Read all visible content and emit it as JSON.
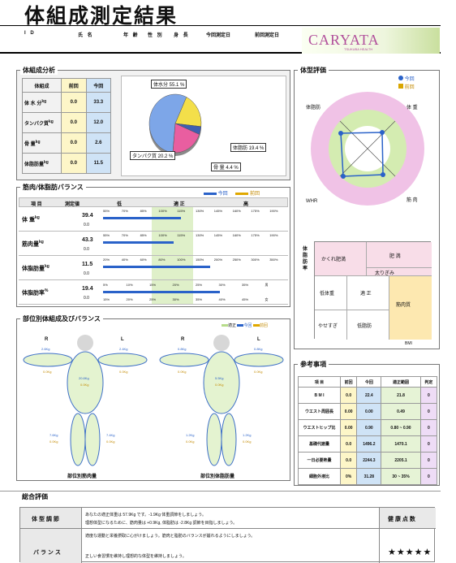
{
  "title": "体組成測定結果",
  "header": {
    "cols": [
      "I D",
      "氏 名",
      "年 齢",
      "性 別",
      "身 長",
      "今回測定日",
      "前回測定日"
    ],
    "logo": "CARYATA",
    "logo_sub": "TSUKUBA HEALTH"
  },
  "body_comp": {
    "title": "体組成分析",
    "headers": [
      "体組成",
      "前回",
      "今回"
    ],
    "rows": [
      {
        "label": "体 水 分",
        "unit": "kg",
        "prev": "0.0",
        "curr": "33.3"
      },
      {
        "label": "タンパク質",
        "unit": "kg",
        "prev": "0.0",
        "curr": "12.0"
      },
      {
        "label": "骨 量",
        "unit": "kg",
        "prev": "0.0",
        "curr": "2.6"
      },
      {
        "label": "体脂肪量",
        "unit": "kg",
        "prev": "0.0",
        "curr": "11.5"
      }
    ],
    "pie_labels": [
      "体水分 55.1 %",
      "タンパク質 20.2 %",
      "骨 量 4.4 %",
      "体脂肪 19.4 %"
    ]
  },
  "chart_data": {
    "type": "pie",
    "categories": [
      "体水分",
      "タンパク質",
      "骨 量",
      "体脂肪"
    ],
    "values": [
      55.1,
      20.2,
      4.4,
      19.4
    ],
    "colors": [
      "#7da6e8",
      "#e95ea0",
      "#3f5fb0",
      "#f3df4a"
    ]
  },
  "balance": {
    "title": "筋肉/体脂肪バランス",
    "legend": [
      "今回",
      "前回"
    ],
    "headers": [
      "項 目",
      "測定値",
      "低",
      "適 正",
      "高"
    ],
    "rows": [
      {
        "label": "体 重",
        "unit": "kg",
        "curr": "39.4",
        "prev": "0.0",
        "scale": [
          "55%",
          "70%",
          "85%",
          "100%",
          "115%",
          "130%",
          "145%",
          "160%",
          "175%",
          "190%"
        ],
        "bar_frac": 0.42
      },
      {
        "label": "筋肉量",
        "unit": "kg",
        "curr": "43.3",
        "prev": "0.0",
        "scale": [
          "55%",
          "70%",
          "85%",
          "100%",
          "115%",
          "130%",
          "145%",
          "160%",
          "175%",
          "190%"
        ],
        "bar_frac": 0.38
      },
      {
        "label": "体脂肪量",
        "unit": "kg",
        "curr": "11.5",
        "prev": "0.0",
        "scale": [
          "20%",
          "40%",
          "60%",
          "80%",
          "100%",
          "150%",
          "200%",
          "250%",
          "300%",
          "350%"
        ],
        "bar_frac": 0.58
      },
      {
        "label": "体脂肪率",
        "unit": "%",
        "curr": "19.4",
        "prev": "0.0",
        "scale_top": [
          "5%",
          "10%",
          "15%",
          "20%",
          "25%",
          "30%",
          "35%",
          "男"
        ],
        "scale_bot": [
          "15%",
          "20%",
          "25%",
          "30%",
          "35%",
          "40%",
          "45%",
          "女"
        ],
        "bar_frac": 0.63
      }
    ]
  },
  "segment": {
    "title": "部位別体組成及びバランス",
    "legend": [
      "適正",
      "今回",
      "前回"
    ],
    "left_fig": {
      "R": "R",
      "L": "L",
      "arm_r": "2.6Kg",
      "arm_r_prev": "0.0Kg",
      "arm_l": "2.4Kg",
      "arm_l_prev": "0.0Kg",
      "trunk": "20.8Kg",
      "trunk_prev": "0.0Kg",
      "leg_r": "7.6Kg",
      "leg_r_prev": "0.0Kg",
      "leg_l": "7.4Kg",
      "leg_l_prev": "0.0Kg",
      "caption": "部位別筋肉量"
    },
    "right_fig": {
      "R": "R",
      "L": "L",
      "arm_r": "0.8Kg",
      "arm_r_prev": "0.0Kg",
      "arm_l": "0.8Kg",
      "arm_l_prev": "0.0Kg",
      "trunk": "5.5Kg",
      "trunk_prev": "0.0Kg",
      "leg_r": "1.2Kg",
      "leg_r_prev": "0.0Kg",
      "leg_l": "1.2Kg",
      "leg_l_prev": "0.0Kg",
      "caption": "部位別体脂肪量"
    }
  },
  "body_type": {
    "title": "体型評価",
    "legend": [
      "今回",
      "前回"
    ],
    "axes": [
      "体脂肪",
      "体 重",
      "WHR",
      "筋 肉"
    ],
    "grid_ylabel": "体脂肪率",
    "cells": [
      "かくれ肥満",
      "肥 満",
      "太りぎみ",
      "低体重",
      "適 正",
      "筋肉質",
      "やせすぎ",
      "低脂肪"
    ],
    "xlabel": "BMI"
  },
  "reference": {
    "title": "参考事項",
    "headers": [
      "項 目",
      "前回",
      "今回",
      "適正範囲",
      "判定"
    ],
    "rows": [
      {
        "label": "B M I",
        "prev": "0.0",
        "curr": "22.4",
        "range": "21.8",
        "judge": "0"
      },
      {
        "label": "ウエスト周囲長",
        "prev": "0.00",
        "curr": "0.00",
        "range": "0.49",
        "judge": "0"
      },
      {
        "label": "ウエストヒップ比",
        "prev": "0.00",
        "curr": "0.90",
        "range": "0.80 ~ 0.90",
        "judge": "0"
      },
      {
        "label": "基礎代謝量",
        "prev": "0.0",
        "curr": "1496.2",
        "range": "1470.1",
        "judge": "0"
      },
      {
        "label": "一日必要熱量",
        "prev": "0.0",
        "curr": "2244.3",
        "range": "2205.1",
        "judge": "0"
      },
      {
        "label": "細胞外液比",
        "prev": "0%",
        "curr": "31.28",
        "range": "30 ~ 35%",
        "judge": "0"
      }
    ]
  },
  "overall": {
    "title": "総合評価",
    "r1_label": "体 型 調 節",
    "r1_text1": "あなたの適正体重は 57.9Kg です。-1.9Kg 体重調節をしましょう。",
    "r1_text2": "理想体型になるために、筋肉量は +0.9Kg, 体脂肪は -2.8Kg 調節を目指しましょう。",
    "r2_label": "バ ラ ン ス",
    "r2_text1": "適度な運動と栄養摂取に心がけましょう。筋肉と脂肪のバランスが崩れるようにしましょう。",
    "r2_text2": "正しい食習慣を維持し理想的な体型を維持しましょう。",
    "result_label": "健 康 点 数",
    "stars": "★★★★★"
  }
}
